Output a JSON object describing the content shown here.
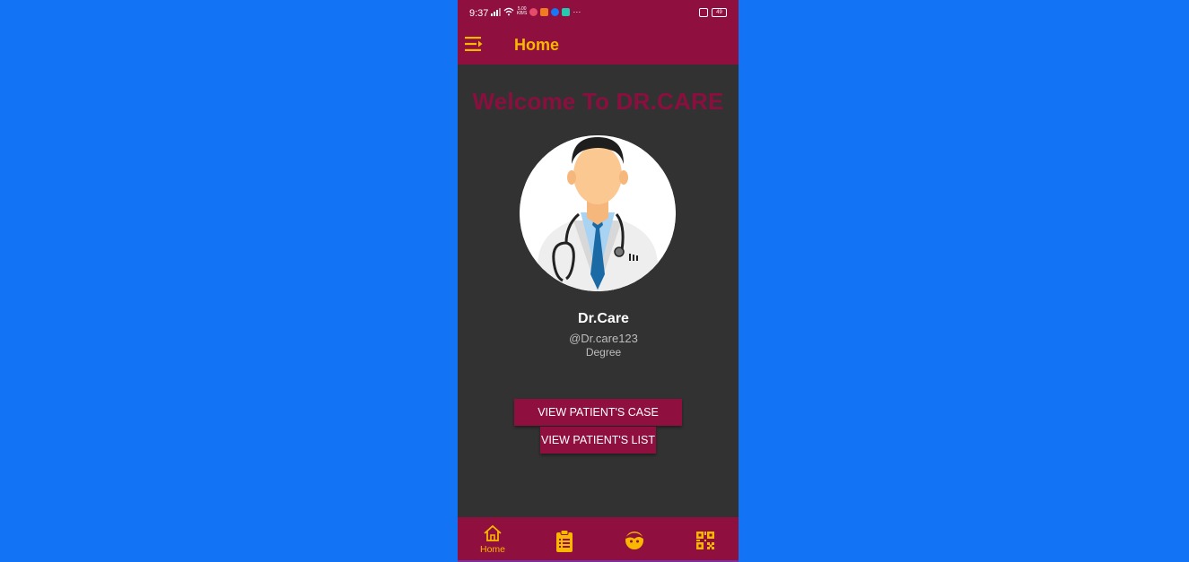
{
  "status_bar": {
    "time": "9:37",
    "speed": "5.00\nKB/S",
    "battery": "49"
  },
  "app_bar": {
    "title": "Home",
    "menu_icon": "menu-open-icon"
  },
  "welcome_text": "Welcome To DR.CARE",
  "profile": {
    "name": "Dr.Care",
    "username": "@Dr.care123",
    "degree": "Degree"
  },
  "buttons": {
    "case_history": "VIEW PATIENT'S CASE HISTORY",
    "patient_list": "VIEW PATIENT'S LIST"
  },
  "bottom_nav": {
    "items": [
      {
        "icon": "home-icon",
        "label": "Home"
      },
      {
        "icon": "clipboard-list-icon",
        "label": ""
      },
      {
        "icon": "face-icon",
        "label": ""
      },
      {
        "icon": "qr-code-icon",
        "label": ""
      }
    ]
  },
  "colors": {
    "page_background": "#1273f5",
    "primary": "#8f0f3e",
    "accent": "#f9b700",
    "content_background": "#323232"
  }
}
